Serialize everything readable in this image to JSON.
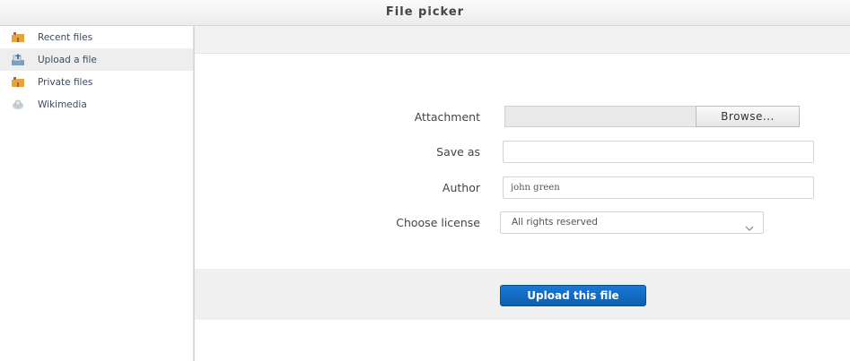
{
  "window": {
    "title": "File picker"
  },
  "sidebar": {
    "items": [
      {
        "label": "Recent files",
        "icon": "folder-icon"
      },
      {
        "label": "Upload a file",
        "icon": "upload-icon"
      },
      {
        "label": "Private files",
        "icon": "folder-icon"
      },
      {
        "label": "Wikimedia",
        "icon": "wikimedia-icon"
      }
    ],
    "active_index": 1
  },
  "form": {
    "attachment": {
      "label": "Attachment",
      "browse_label": "Browse..."
    },
    "save_as": {
      "label": "Save as",
      "value": ""
    },
    "author": {
      "label": "Author",
      "value": "john green"
    },
    "license": {
      "label": "Choose license",
      "selected": "All rights reserved"
    },
    "submit_label": "Upload this file"
  },
  "colors": {
    "primary_button": "#0d66c2",
    "folder_icon": "#e8a33c"
  }
}
